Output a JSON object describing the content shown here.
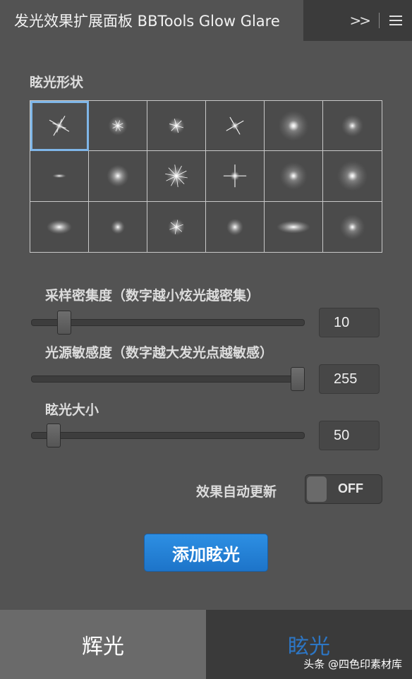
{
  "window": {
    "title": "发光效果扩展面板 BBTools Glow Glare",
    "expand_glyph": ">>"
  },
  "glare_shape": {
    "label": "眩光形状",
    "selected_index": 0,
    "shapes": [
      "star-4-point",
      "soft-dot-burst",
      "sparkle-cluster",
      "star-x-flare",
      "halo-orb",
      "soft-orb",
      "small-streak",
      "cloud-orb",
      "starburst-rays",
      "cross-flare",
      "ringed-orb",
      "large-soft-orb",
      "elliptic-glow",
      "small-dot-glow",
      "star-sparkle",
      "round-glow",
      "horizontal-ellipse",
      "dim-orb"
    ]
  },
  "sliders": [
    {
      "label": "采样密集度（数字越小炫光越密集）",
      "value": "10",
      "level": 0.1
    },
    {
      "label": "光源敏感度（数字越大发光点越敏感）",
      "value": "255",
      "level": 1.0
    },
    {
      "label": "眩光大小",
      "value": "50",
      "level": 0.06
    }
  ],
  "auto_update": {
    "label": "效果自动更新",
    "state_label": "OFF"
  },
  "add_button": {
    "label": "添加眩光"
  },
  "tabs": [
    {
      "label": "辉光",
      "active": true
    },
    {
      "label": "眩光",
      "active": false
    }
  ],
  "watermark": {
    "text": "头条 @四色印素材库"
  },
  "colors": {
    "panel_bg": "#535353",
    "accent_blue": "#1d74c9",
    "selected_outline": "#7fb6e8"
  }
}
